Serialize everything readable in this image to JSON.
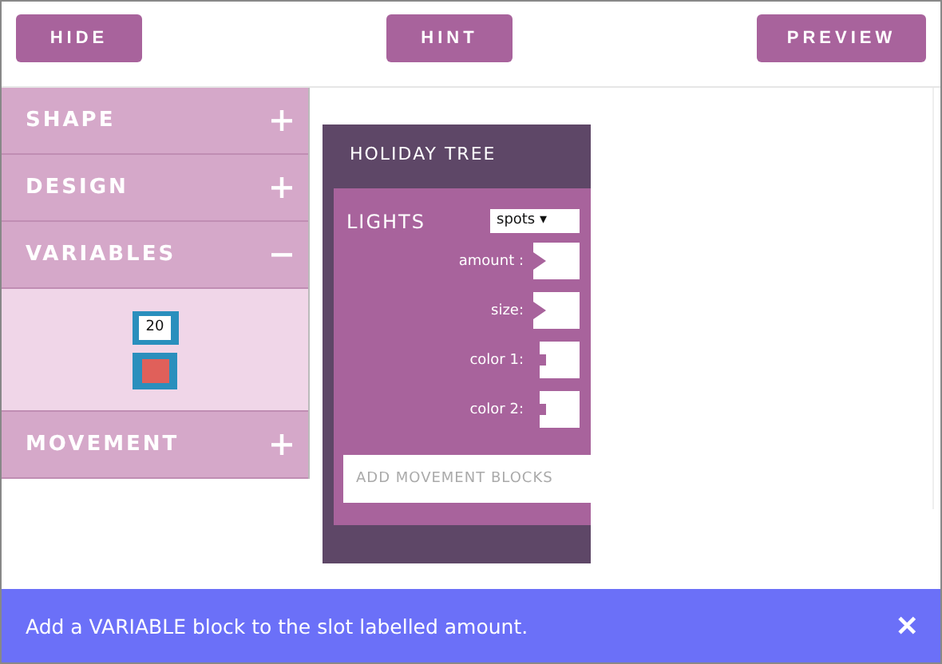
{
  "toolbar": {
    "buttons": [
      {
        "label": "HIDE"
      },
      {
        "label": "HINT"
      },
      {
        "label": "PREVIEW"
      }
    ]
  },
  "sidebar": {
    "categories": [
      {
        "label": "SHAPE",
        "expanded": false
      },
      {
        "label": "DESIGN",
        "expanded": false
      },
      {
        "label": "VARIABLES",
        "expanded": true,
        "blocks": [
          {
            "kind": "number",
            "value": "20"
          },
          {
            "kind": "color",
            "color": "#e0605a"
          }
        ]
      },
      {
        "label": "MOVEMENT",
        "expanded": false
      }
    ]
  },
  "workspace": {
    "block": {
      "title": "HOLIDAY TREE",
      "lights": {
        "label": "LIGHTS",
        "dropdown": "spots ▾",
        "slots": [
          {
            "label": "amount :",
            "kind": "value"
          },
          {
            "label": "size:",
            "kind": "value"
          },
          {
            "label": "color 1:",
            "kind": "color"
          },
          {
            "label": "color 2:",
            "kind": "color"
          }
        ]
      },
      "movement_slot": {
        "placeholder": "ADD MOVEMENT BLOCKS"
      }
    }
  },
  "hint_banner": {
    "message": "Add a VARIABLE block to the slot labelled amount.",
    "close": "✕"
  }
}
